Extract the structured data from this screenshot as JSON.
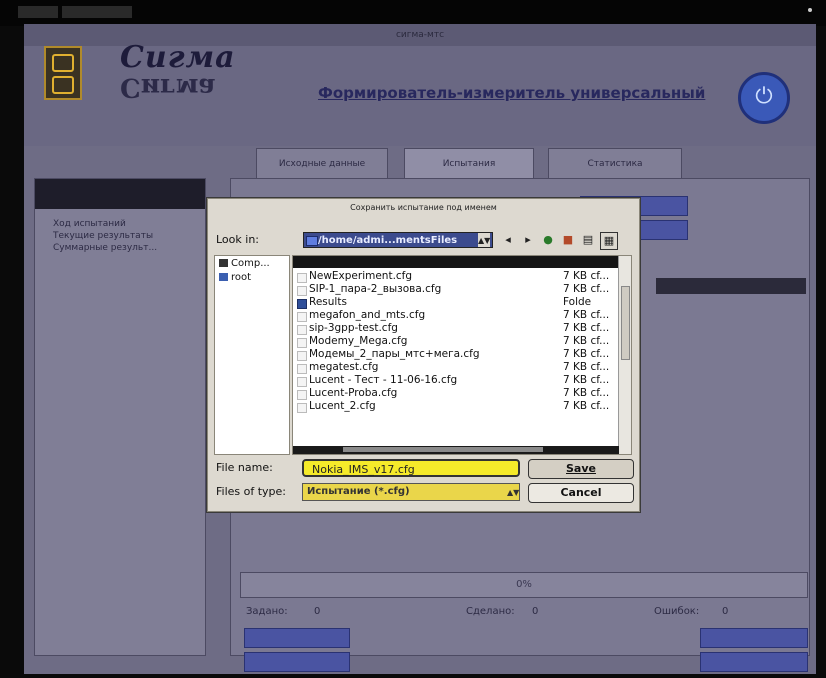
{
  "window": {
    "title": "сигма-мтс"
  },
  "header": {
    "logo_text": "Сигма",
    "logo_reflection": "Сигма",
    "app_title": "Формирователь-измеритель универсальный",
    "power_icon": "power-icon"
  },
  "tabs": [
    {
      "label": "Исходные данные"
    },
    {
      "label": "Испытания"
    },
    {
      "label": "Статистика"
    }
  ],
  "left_panel": {
    "items": [
      {
        "label": "Ход испытаний"
      },
      {
        "label": "Текущие результаты"
      },
      {
        "label": "Суммарные результ..."
      }
    ]
  },
  "status": {
    "progress": "0%",
    "set_label": "Задано:",
    "set_value": "0",
    "done_label": "Сделано:",
    "done_value": "0",
    "errors_label": "Ошибок:",
    "errors_value": "0"
  },
  "dialog": {
    "title": "Сохранить испытание под именем",
    "look_in_label": "Look in:",
    "path": "/home/admi...mentsFiles",
    "toolbar_icons": [
      "back-icon",
      "forward-icon",
      "up-folder-icon",
      "new-folder-icon",
      "list-view-icon",
      "detail-view-icon"
    ],
    "sidebar": [
      {
        "label": "Comp...",
        "icon": "computer-icon"
      },
      {
        "label": "root",
        "icon": "folder-icon"
      }
    ],
    "files": [
      {
        "name": "NewExperiment.cfg",
        "size": "7 KB cf...",
        "type": "file"
      },
      {
        "name": "SIP-1_пара-2_вызова.cfg",
        "size": "7 KB cf...",
        "type": "file"
      },
      {
        "name": "Results",
        "size": "Folde",
        "type": "folder"
      },
      {
        "name": "megafon_and_mts.cfg",
        "size": "7 KB cf...",
        "type": "file"
      },
      {
        "name": "sip-3gpp-test.cfg",
        "size": "7 KB cf...",
        "type": "file"
      },
      {
        "name": "Modemy_Mega.cfg",
        "size": "7 KB cf...",
        "type": "file"
      },
      {
        "name": "Модемы_2_пары_мтс+мега.cfg",
        "size": "7 KB cf...",
        "type": "file"
      },
      {
        "name": "megatest.cfg",
        "size": "7 KB cf...",
        "type": "file"
      },
      {
        "name": "Lucent - Тест - 11-06-16.cfg",
        "size": "7 KB cf...",
        "type": "file"
      },
      {
        "name": "Lucent-Proba.cfg",
        "size": "7 KB cf...",
        "type": "file"
      },
      {
        "name": "Lucent_2.cfg",
        "size": "7 KB cf...",
        "type": "file"
      }
    ],
    "file_name_label": "File name:",
    "file_name_value": "Nokia_IMS_v17.cfg",
    "file_type_label": "Files of type:",
    "file_type_value": "Испытание (*.cfg)",
    "save_label": "Save",
    "cancel_label": "Cancel"
  }
}
